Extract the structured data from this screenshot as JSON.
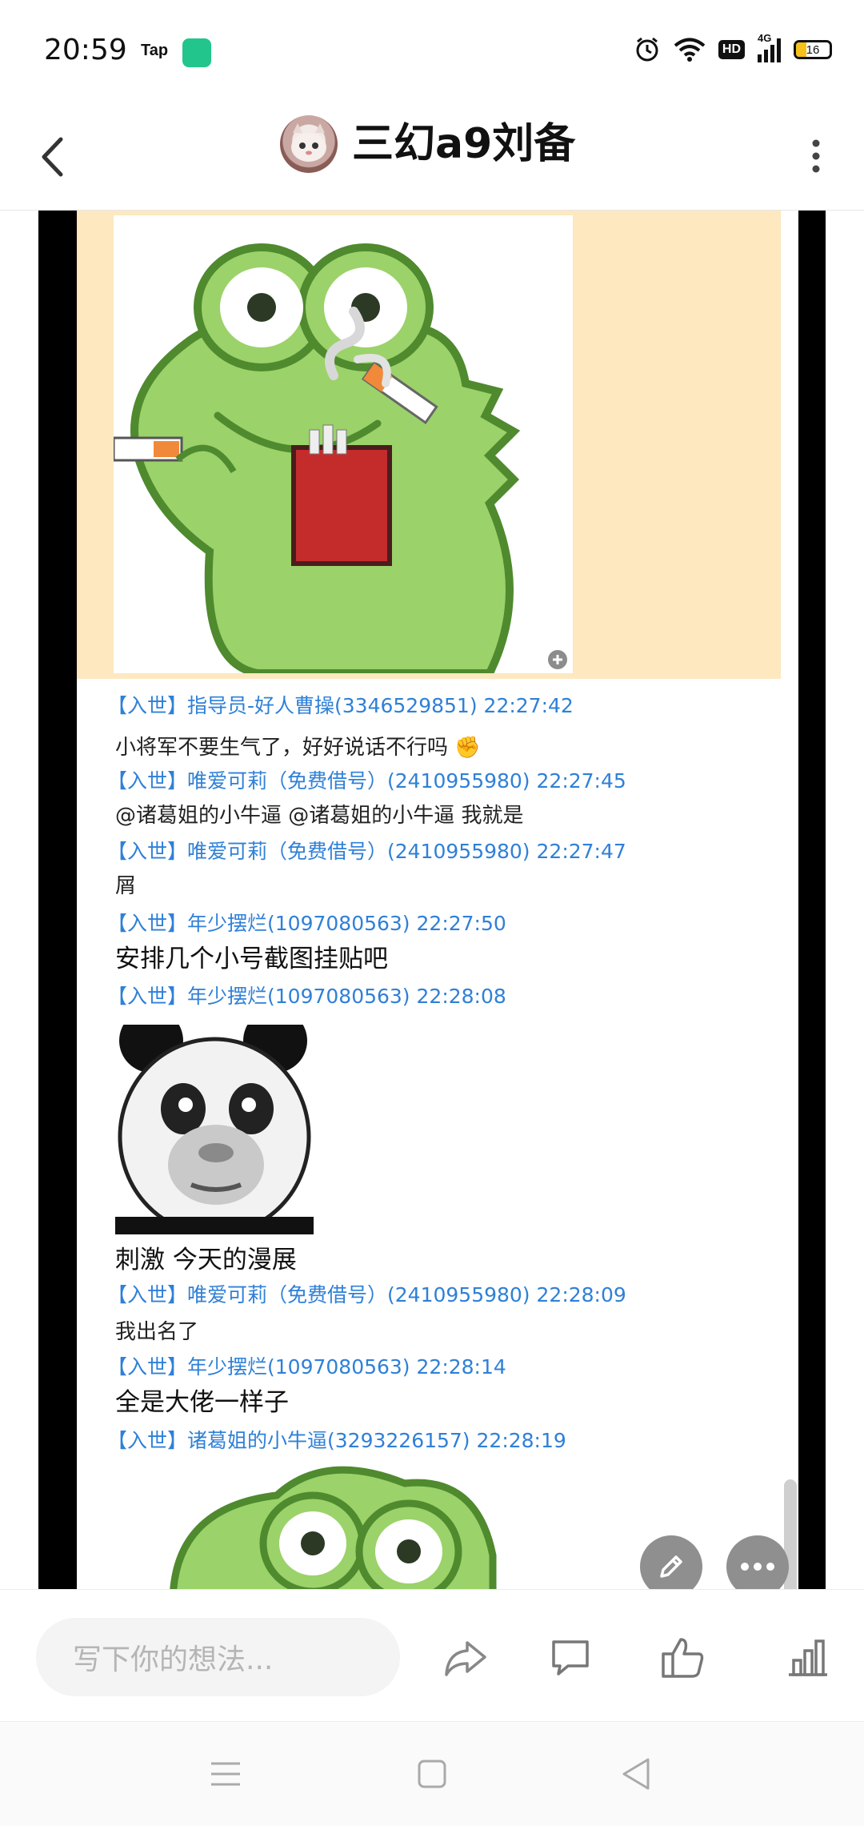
{
  "status_bar": {
    "time": "20:59",
    "tap_label": "Tap",
    "battery_level": "16",
    "hd_label": "HD",
    "network_label": "4G"
  },
  "header": {
    "title": "三幻a9刘备"
  },
  "post": {
    "chat": [
      {
        "kind": "meta",
        "text": "【入世】指导员-好人曹操(3346529851) 22:27:42"
      },
      {
        "kind": "msg",
        "text": "小将军不要生气了，好好说话不行吗 ✊"
      },
      {
        "kind": "meta",
        "text": "【入世】唯爱可莉（免费借号）(2410955980) 22:27:45"
      },
      {
        "kind": "msg",
        "text": "@诸葛姐的小牛逼 @诸葛姐的小牛逼 我就是"
      },
      {
        "kind": "meta",
        "text": "【入世】唯爱可莉（免费借号）(2410955980) 22:27:47"
      },
      {
        "kind": "msg",
        "text": "屑"
      },
      {
        "kind": "meta",
        "text": "【入世】年少摆烂(1097080563) 22:27:50"
      },
      {
        "kind": "msg-big",
        "text": "安排几个小号截图挂贴吧"
      },
      {
        "kind": "meta",
        "text": "【入世】年少摆烂(1097080563) 22:28:08"
      },
      {
        "kind": "msg-big",
        "text": "刺激 今天的漫展"
      },
      {
        "kind": "meta",
        "text": "【入世】唯爱可莉（免费借号）(2410955980) 22:28:09"
      },
      {
        "kind": "msg",
        "text": "我出名了"
      },
      {
        "kind": "meta",
        "text": "【入世】年少摆烂(1097080563) 22:28:14"
      },
      {
        "kind": "msg-big",
        "text": "全是大佬一样子"
      },
      {
        "kind": "meta",
        "text": "【入世】诸葛姐的小牛逼(3293226157) 22:28:19"
      }
    ]
  },
  "bottom_bar": {
    "comment_placeholder": "写下你的想法..."
  },
  "colors": {
    "meta_blue": "#2f80d7",
    "sticker_bg": "#fde8c0",
    "frog_green": "#9bd26a",
    "frog_outline": "#4f8a2e"
  }
}
